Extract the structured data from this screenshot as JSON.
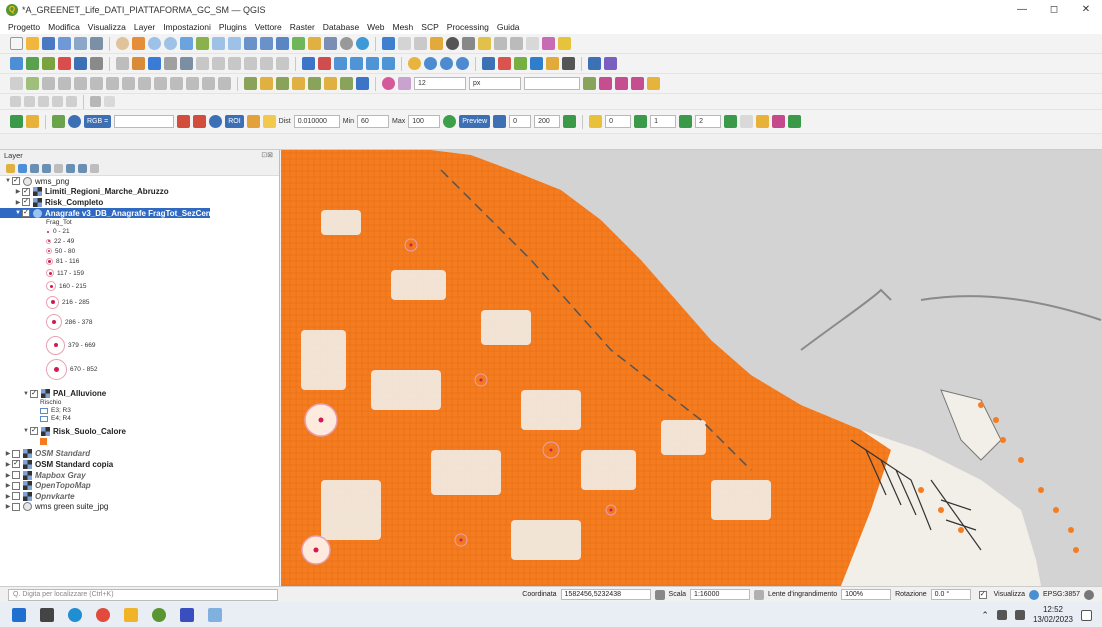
{
  "window": {
    "title": "*A_GREENET_Life_DATI_PIATTAFORMA_GC_SM — QGIS",
    "app_icon": "Q",
    "controls": [
      "—",
      "◻",
      "✕"
    ]
  },
  "menu": [
    "Progetto",
    "Modifica",
    "Visualizza",
    "Layer",
    "Impostazioni",
    "Plugins",
    "Vettore",
    "Raster",
    "Database",
    "Web",
    "Mesh",
    "SCP",
    "Processing",
    "Guida"
  ],
  "toolbars": {
    "row4": {
      "font_size": "12",
      "unit": "px"
    },
    "scp": {
      "rgb": "RGB =",
      "roi": "ROI",
      "dist_label": "Dist",
      "dist_value": "0.010000",
      "min_label": "Min",
      "min_value": "60",
      "max_label": "Max",
      "max_value": "100",
      "preview": "Preview",
      "v1": "0",
      "v2": "200",
      "v3": "0",
      "v4": "1",
      "v5": "2"
    }
  },
  "panel": {
    "title": "Layer",
    "header_buttons": "⊡⊠",
    "tree": {
      "root": "wms_png",
      "limiti": "Limiti_Regioni_Marche_Abruzzo",
      "risk_completo": "Risk_Completo",
      "anagrafe": "Anagrafe v3_DB_Anagrafe FragTot_SezCens",
      "legend_title": "Frag_Tot",
      "legend": [
        "0 - 21",
        "22 - 49",
        "50 - 80",
        "81 - 116",
        "117 - 159",
        "160 - 215",
        "216 - 285",
        "286 - 378",
        "379 - 669",
        "670 - 852"
      ],
      "pai": "PAI_Alluvione",
      "pai_sub": "Rischio",
      "pai_legend": [
        "E3; R3",
        "E4; R4"
      ],
      "risk_suolo": "Risk_Suolo_Calore",
      "osm_standard": "OSM Standard",
      "osm_copia": "OSM Standard copia",
      "mapbox": "Mapbox Gray",
      "opentopo": "OpenTopoMap",
      "opnv": "Opnvkarte",
      "green_suite": "wms green suite_jpg"
    }
  },
  "colors": {
    "risk_fill": "#f57c1f",
    "selection": "#2f69c2",
    "sea": "#d3d3d3",
    "land": "#f2efe9"
  },
  "status": {
    "locator_placeholder": "Q. Digita per localizzare (Ctrl+K)",
    "coord_label": "Coordinata",
    "coord_value": "1582456,5232438",
    "scale_label": "Scala",
    "scale_value": "1:16000",
    "magnifier_label": "Lente d'ingrandimento",
    "magnifier_value": "100%",
    "rotation_label": "Rotazione",
    "rotation_value": "0.0 °",
    "render_label": "Visualizza",
    "crs": "EPSG:3857"
  },
  "taskbar": {
    "time": "12:52",
    "date": "13/02/2023"
  }
}
